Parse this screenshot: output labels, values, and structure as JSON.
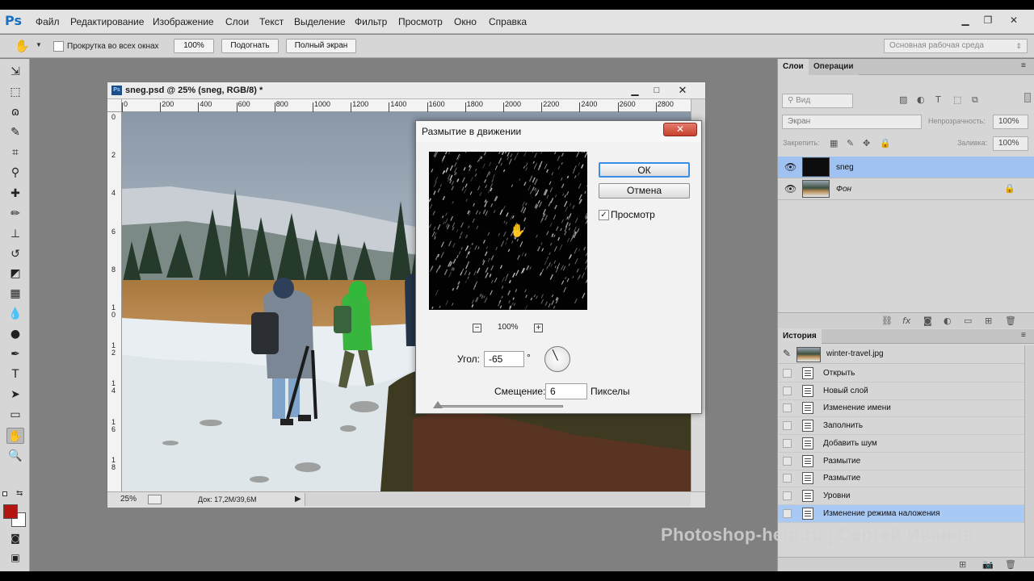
{
  "menubar": {
    "logo": "Ps",
    "items": [
      "Файл",
      "Редактирование",
      "Изображение",
      "Слои",
      "Текст",
      "Выделение",
      "Фильтр",
      "Просмотр",
      "Окно",
      "Справка"
    ]
  },
  "options": {
    "scroll_all_label": "Прокрутка во всех окнах",
    "zoom_100_label": "100%",
    "fit_label": "Подогнать",
    "fullscreen_label": "Полный экран",
    "workspace": "Основная рабочая среда"
  },
  "document": {
    "title": "sneg.psd @ 25% (sneg, RGB/8) *",
    "ruler_h": [
      "0",
      "200",
      "400",
      "600",
      "800",
      "1000",
      "1200",
      "1400",
      "1600",
      "1800",
      "2000",
      "2200",
      "2400",
      "2600",
      "2800"
    ],
    "ruler_v": [
      "0",
      "2",
      "4",
      "6",
      "8",
      "1 0",
      "1 2",
      "1 4",
      "1 6",
      "1 8"
    ],
    "zoom": "25%",
    "doc_info": "Док: 17,2M/39,6M"
  },
  "dialog": {
    "title": "Размытие в движении",
    "ok_label": "ОК",
    "cancel_label": "Отмена",
    "preview_label": "Просмотр",
    "preview_checked": true,
    "preview_zoom": "100%",
    "angle_label": "Угол:",
    "angle_value": "-65",
    "angle_unit": "°",
    "distance_label": "Смещение:",
    "distance_value": "6",
    "distance_unit": "Пикселы"
  },
  "layers_panel": {
    "tab_layers": "Слои",
    "tab_operations": "Операции",
    "filter_kind": "Вид",
    "blend_mode": "Экран",
    "opacity_label": "Непрозрачность:",
    "opacity_value": "100%",
    "lock_label": "Закрепить:",
    "fill_label": "Заливка:",
    "fill_value": "100%",
    "layers": [
      {
        "name": "sneg",
        "selected": true
      },
      {
        "name": "Фон",
        "selected": false
      }
    ]
  },
  "history_panel": {
    "tab": "История",
    "snapshot": "winter-travel.jpg",
    "items": [
      "Открыть",
      "Новый слой",
      "Изменение имени",
      "Заполнить",
      "Добавить шум",
      "Размытие",
      "Размытие",
      "Уровни",
      "Изменение режима наложения"
    ]
  },
  "colors": {
    "foreground": "#b3160f",
    "background": "#ffffff",
    "selection": "#9fc2f2",
    "history_selected": "#a9c9f5"
  },
  "watermark": "Photoshop-help.ru  | Сергей Иванов"
}
